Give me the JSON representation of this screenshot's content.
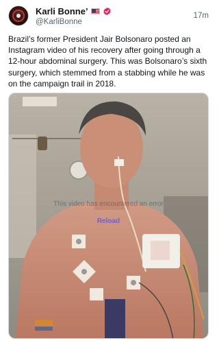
{
  "author": {
    "display_name": "Karli Bonne’",
    "handle": "@KarliBonne",
    "flag_icon": "us-flag-icon",
    "badge_icon": "verified-badge-icon",
    "badge_color": "#e0245e"
  },
  "timestamp": "17m",
  "tweet_text": "Brazil’s former President Jair Bolsonaro posted an Instagram video of his recovery after going through a 12-hour abdominal surgery. This was Bolsonaro’s sixth surgery, which stemmed from a stabbing while he was on the campaign trail in 2018.",
  "media": {
    "error_message": "This video has encountered an error",
    "reload_label": "Reload"
  }
}
